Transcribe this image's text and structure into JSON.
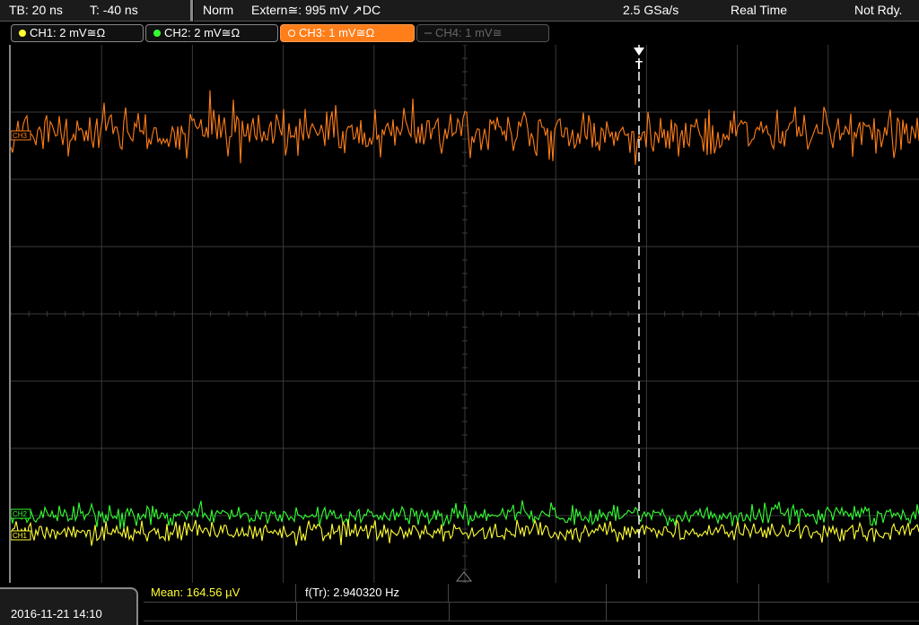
{
  "header": {
    "timebase": "TB: 20 ns",
    "trigger_time": "T: -40 ns",
    "acq_mode": "Norm",
    "trigger_info": "Extern≅: 995 mV ↗DC",
    "sample_rate": "2.5 GSa/s",
    "acq_type": "Real Time",
    "status": "Not Rdy."
  },
  "channels": [
    {
      "label": "CH1: 2 mV≅Ω",
      "color": "#ffff33",
      "state": "on"
    },
    {
      "label": "CH2: 2 mV≅Ω",
      "color": "#33ff33",
      "state": "on"
    },
    {
      "label": "CH3: 1 mV≅Ω",
      "color": "#ff7e19",
      "state": "active"
    },
    {
      "label": "CH4: 1 mV≅",
      "color": "#666666",
      "state": "off"
    }
  ],
  "markers": {
    "ch3": "CH3",
    "ch2": "CH2",
    "ch1": "CH1",
    "trigger": "T"
  },
  "footer": {
    "datetime": "2016-11-21 14:10",
    "mean": "Mean: 164.56 µV",
    "frequency": "f(Tr): 2.940320 Hz"
  },
  "colors": {
    "ch1": "#ffff33",
    "ch2": "#33ff33",
    "ch3": "#ff7e19",
    "grid": "#3a3a3a"
  }
}
